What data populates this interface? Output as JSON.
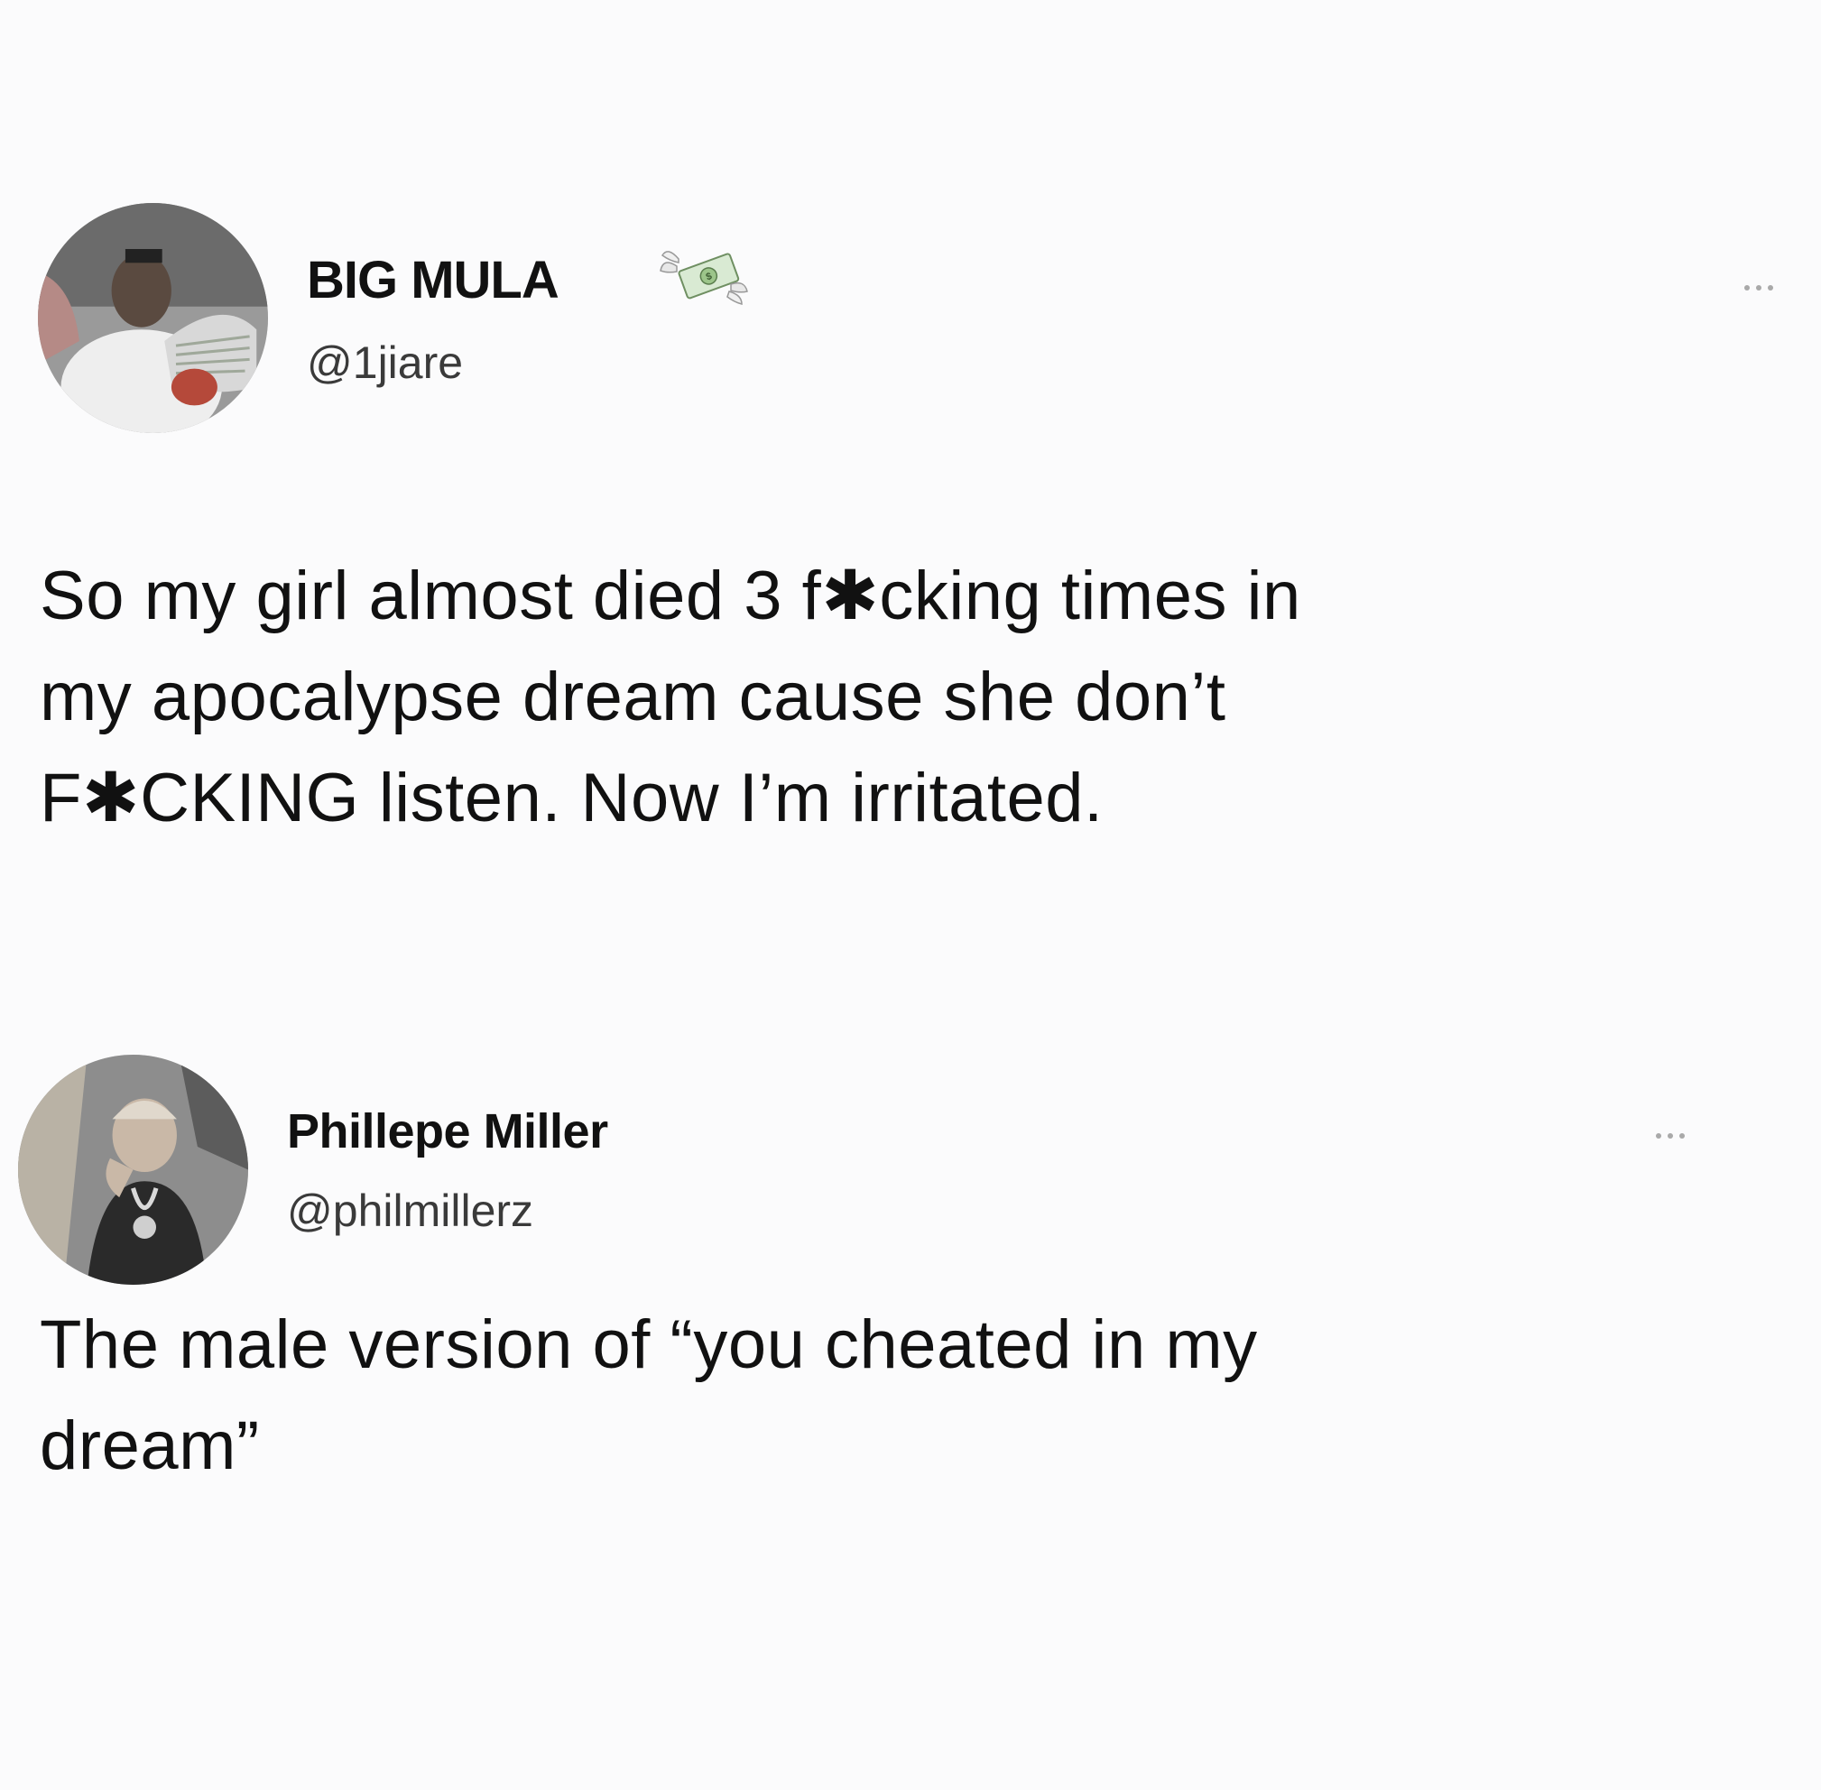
{
  "tweets": [
    {
      "display_name": "BIG MULA",
      "display_name_emoji": "money-with-wings-emoji",
      "handle": "@1jiare",
      "more_icon": "more-options-icon",
      "text_lines": [
        "So my girl almost died 3 f✱cking times in",
        "my apocalypse dream cause she don’t",
        "F✱CKING listen. Now I’m irritated."
      ]
    },
    {
      "display_name": "Phillepe Miller",
      "handle": "@philmillerz",
      "more_icon": "more-options-icon",
      "text_lines": [
        "The male version of “you cheated in my",
        "dream”"
      ]
    }
  ],
  "colors": {
    "background": "#fbfbfc",
    "text": "#111111",
    "handle": "#3a3a3a",
    "more_dots": "#a9a9a9"
  }
}
